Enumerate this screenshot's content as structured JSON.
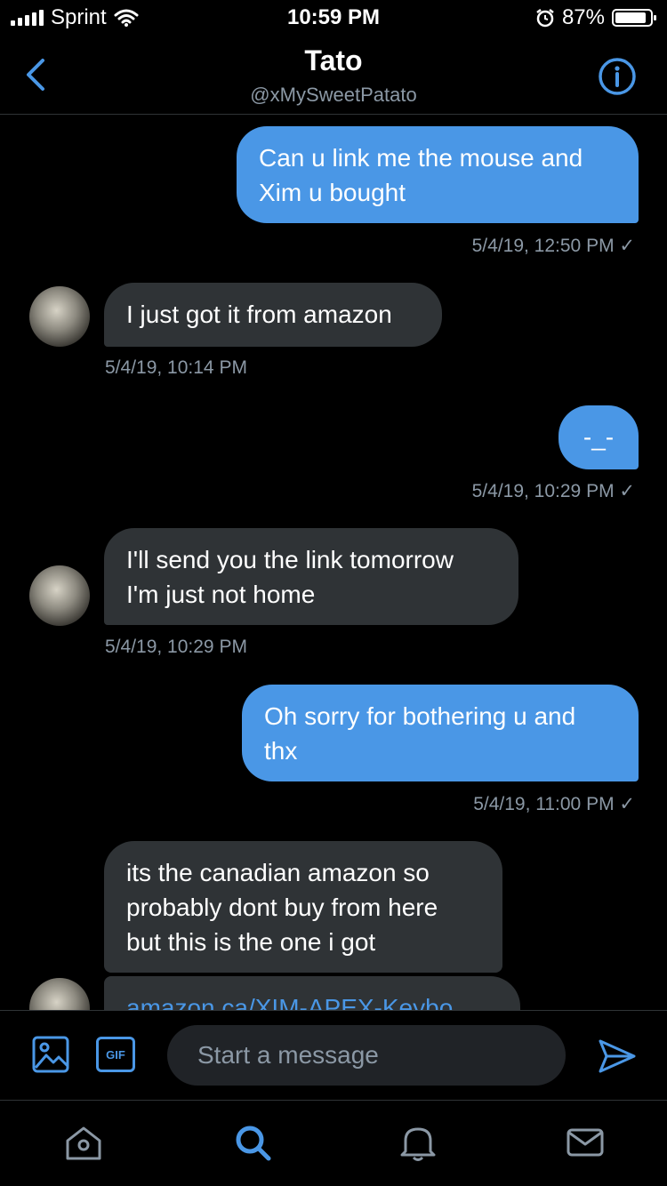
{
  "status_bar": {
    "carrier": "Sprint",
    "time": "10:59 PM",
    "battery": "87%",
    "battery_level": 0.87,
    "icons": [
      "signal-icon",
      "wifi-icon",
      "alarm-icon",
      "battery-icon"
    ]
  },
  "header": {
    "title": "Tato",
    "handle": "@xMySweetPatato",
    "icons": [
      "back-chevron-icon",
      "info-icon"
    ]
  },
  "messages": [
    {
      "direction": "sent",
      "lines": [
        "Can u link me the mouse and",
        "Xim u bought"
      ],
      "timestamp": "5/4/19, 12:50 PM ✓"
    },
    {
      "direction": "received",
      "lines": [
        "I just got it from amazon"
      ],
      "timestamp": "5/4/19, 10:14 PM"
    },
    {
      "direction": "sent",
      "lines": [
        "-_-"
      ],
      "timestamp": "5/4/19, 10:29 PM ✓"
    },
    {
      "direction": "received",
      "lines": [
        "I'll send you the link tomorrow",
        "I'm just not home"
      ],
      "timestamp": "5/4/19, 10:29 PM"
    },
    {
      "direction": "sent",
      "lines": [
        "Oh sorry for bothering u and",
        "thx"
      ],
      "timestamp": "5/4/19, 11:00 PM ✓"
    },
    {
      "direction": "received",
      "lines": [
        "its the canadian amazon so",
        "probably dont buy from here",
        "but this is the one i got"
      ],
      "timestamp": ""
    },
    {
      "direction": "received",
      "lines": [
        "amazon.ca/XIM-APEX-Keybo"
      ],
      "timestamp": ""
    }
  ],
  "composer": {
    "placeholder": "Start a message",
    "gif_label": "GIF",
    "icons": [
      "image-icon",
      "gif-icon",
      "send-icon"
    ]
  },
  "tab_bar": {
    "items": [
      "home-icon",
      "search-icon",
      "notifications-icon",
      "messages-icon"
    ],
    "active": "search-icon"
  },
  "colors": {
    "accent": "#4a97e6",
    "background": "#000000",
    "received_bubble": "#2f3336",
    "secondary_text": "#8b98a5"
  }
}
